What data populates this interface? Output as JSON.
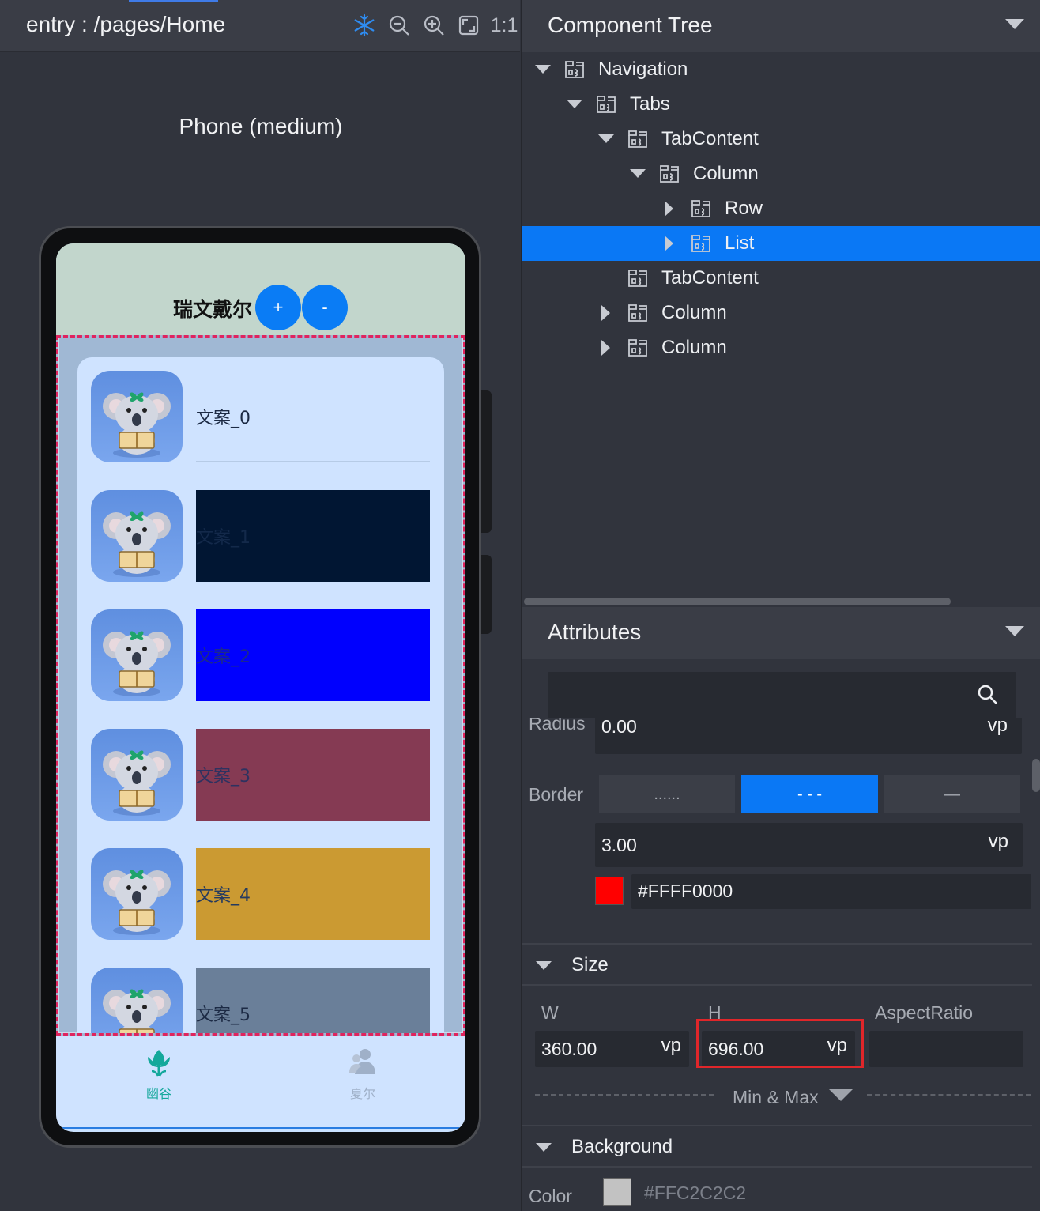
{
  "preview": {
    "entry_path": "entry : /pages/Home",
    "toolbar": {
      "freeze_icon": "snowflake-icon",
      "zoom_out_icon": "zoom-out-icon",
      "zoom_in_icon": "zoom-in-icon",
      "fit_icon": "fit-screen-icon",
      "actual_size_label": "1:1"
    },
    "device_label": "Phone (medium)",
    "app": {
      "title": "瑞文戴尔",
      "plus_label": "+",
      "minus_label": "-",
      "list_items": [
        {
          "text": "文案_0",
          "bg": "",
          "color": "#1c2a44"
        },
        {
          "text": "文案_1",
          "bg": "#011633",
          "color": "#13294a"
        },
        {
          "text": "文案_2",
          "bg": "#0000fe",
          "color": "#1c2a8a"
        },
        {
          "text": "文案_3",
          "bg": "#853a53",
          "color": "#2d3260"
        },
        {
          "text": "文案_4",
          "bg": "#cb9a32",
          "color": "#253a60"
        },
        {
          "text": "文案_5",
          "bg": "#6a7f99",
          "color": "#1c2a44"
        }
      ],
      "tabs": [
        {
          "label": "幽谷",
          "icon": "tulip-icon",
          "color": "#14a89b"
        },
        {
          "label": "夏尔",
          "icon": "users-icon",
          "color": "#9fb0c8"
        }
      ],
      "border_color": "#e0245e"
    }
  },
  "component_tree": {
    "title": "Component Tree",
    "nodes": [
      {
        "label": "Navigation",
        "expanded": true
      },
      {
        "label": "Tabs",
        "expanded": true
      },
      {
        "label": "TabContent",
        "expanded": true
      },
      {
        "label": "Column",
        "expanded": true
      },
      {
        "label": "Row",
        "expanded": false
      },
      {
        "label": "List",
        "expanded": false,
        "selected": true
      },
      {
        "label": "TabContent"
      },
      {
        "label": "Column",
        "expanded": false
      },
      {
        "label": "Column",
        "expanded": false
      }
    ]
  },
  "attributes": {
    "title": "Attributes",
    "search_placeholder": "",
    "radius": {
      "label": "Radius",
      "value": "0.00",
      "unit": "vp"
    },
    "border": {
      "label": "Border",
      "styles": [
        "......",
        "- - -",
        "—"
      ],
      "selected_style": "- - -",
      "width": "3.00",
      "width_unit": "vp",
      "color": "#FFFF0000",
      "color_swatch": "#ff0000"
    },
    "size": {
      "title": "Size",
      "w_label": "W",
      "w_value": "360.00",
      "w_unit": "vp",
      "h_label": "H",
      "h_value": "696.00",
      "h_unit": "vp",
      "aspect_label": "AspectRatio",
      "aspect_value": "",
      "min_max_label": "Min & Max"
    },
    "background": {
      "title": "Background",
      "color_label": "Color",
      "color_value": "#FFC2C2C2",
      "color_swatch": "#c2c2c2"
    }
  },
  "colors": {
    "accent": "#0a78f5",
    "highlight": "#e0262a"
  }
}
